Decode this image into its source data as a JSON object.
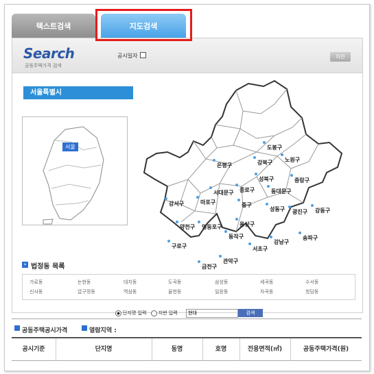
{
  "tabs": [
    {
      "label": "텍스트검색"
    },
    {
      "label": "지도검색"
    }
  ],
  "header": {
    "logo": "Search",
    "logo_sub": "공동주택가격 검색",
    "date_label": "공시일자",
    "prev_label": "이전"
  },
  "region_title": "서울특별시",
  "korea_pin": "서울",
  "districts": [
    "도봉구",
    "노원구",
    "강북구",
    "은평구",
    "성북구",
    "중랑구",
    "종로구",
    "동대문구",
    "서대문구",
    "마포구",
    "중구",
    "광진구",
    "강서구",
    "성동구",
    "용산구",
    "강동구",
    "양천구",
    "영등포구",
    "동작구",
    "서초구",
    "강남구",
    "송파구",
    "구로구",
    "관악구",
    "금천구"
  ],
  "dong_section": {
    "title": "법정동 목록",
    "items": [
      "가로동",
      "논현동",
      "대치동",
      "도곡동",
      "삼성동",
      "세곡동",
      "수서동",
      "신사동",
      "압구정동",
      "역삼동",
      "율현동",
      "일원동",
      "자곡동",
      "청담동"
    ]
  },
  "search": {
    "opt1": "단지명 입력",
    "opt2": "지번 입력",
    "value": "현대",
    "button": "검색"
  },
  "bottom": {
    "title1": "공동주택공시가격",
    "title2": "열람지역 :"
  },
  "table": {
    "headers": [
      "공시기준",
      "단지명",
      "동명",
      "호명",
      "전용면적(㎡)",
      "공동주택가격(원)"
    ]
  },
  "colors": {
    "tab_active": "#4aa3e8",
    "accent": "#2d8fd8",
    "highlight": "#e51b1b"
  }
}
